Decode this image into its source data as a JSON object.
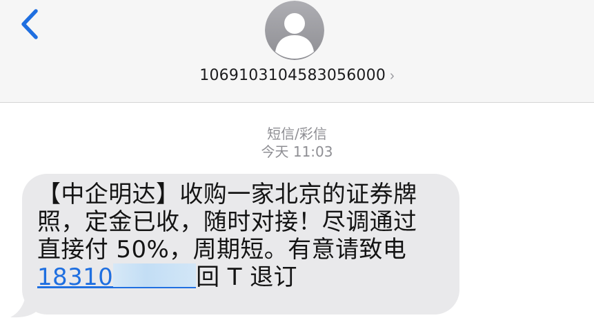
{
  "header": {
    "contact_number": "106910310458305600",
    "contact_number_tail": "0",
    "chevron": "›"
  },
  "icons": {
    "back": "chevron-left-icon",
    "avatar": "person-silhouette-icon",
    "disclosure": "chevron-right-icon"
  },
  "conversation": {
    "message_type": "短信/彩信",
    "timestamp": "今天 11:03",
    "message": {
      "line1": "【中企明达】收购一家北京的证券牌",
      "line2": "照，定金已收，随时对接！尽调通过",
      "line3": "直接付 50%，周期短。有意请致电",
      "phone_visible": "18310",
      "suffix": "回 T 退订"
    }
  },
  "colors": {
    "accent": "#1f6fe0",
    "bubble": "#e9e9eb",
    "header_bg": "#f6f6f6",
    "avatar": "#a4a4aa"
  }
}
